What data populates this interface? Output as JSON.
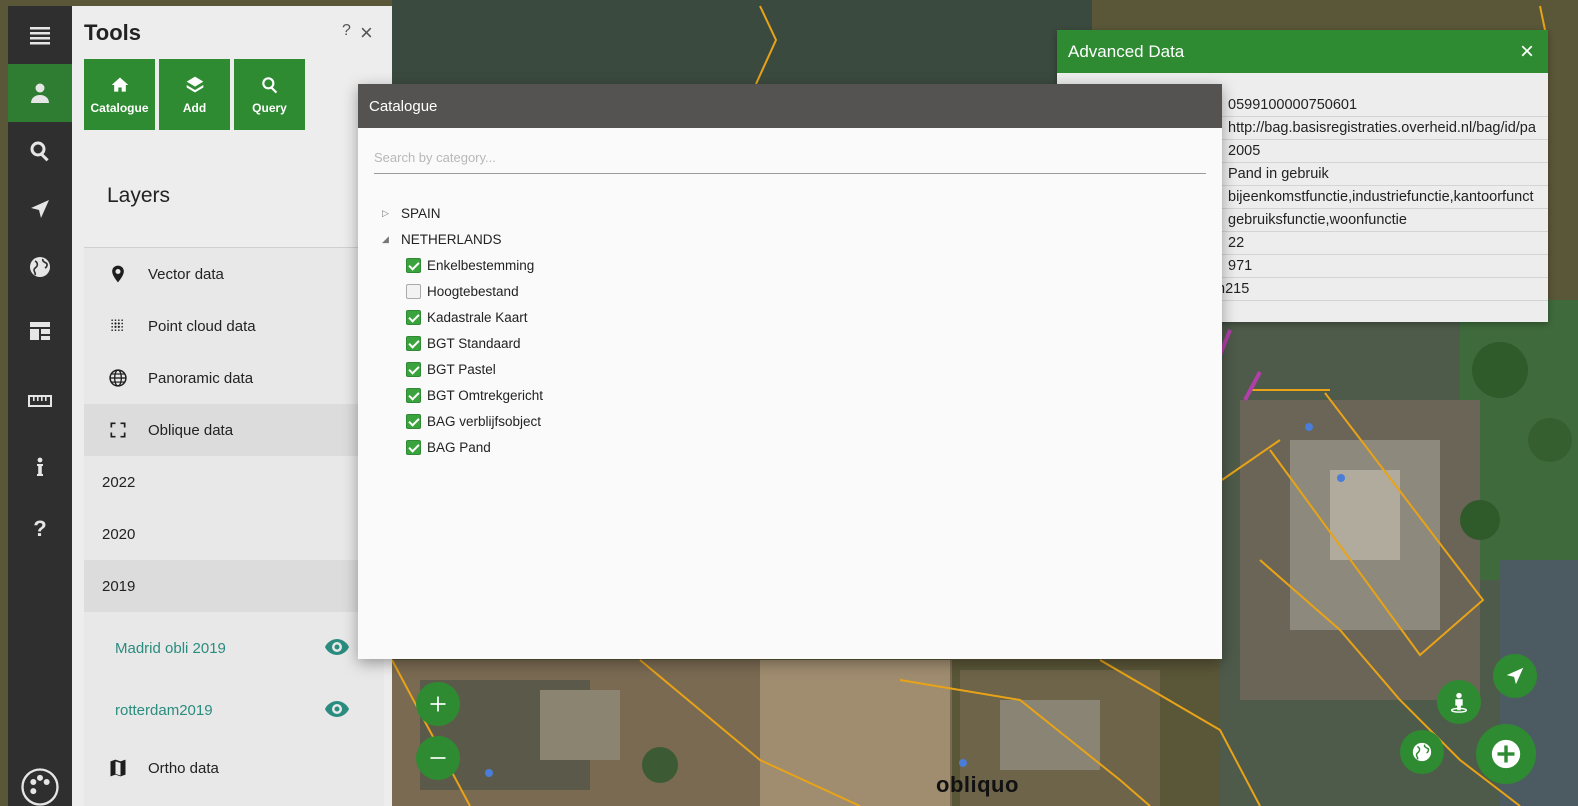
{
  "rail": {
    "items": [
      "menu",
      "user",
      "search",
      "navigate",
      "globe",
      "dashboard",
      "measure",
      "info",
      "help",
      "palette"
    ]
  },
  "tools": {
    "title": "Tools",
    "help": "?",
    "close": "×",
    "buttons": [
      {
        "label": "Catalogue",
        "icon": "home-icon"
      },
      {
        "label": "Add",
        "icon": "layers-icon"
      },
      {
        "label": "Query",
        "icon": "search-icon"
      }
    ]
  },
  "layers": {
    "title": "Layers",
    "categories": [
      {
        "label": "Vector data",
        "icon": "map-marker-icon"
      },
      {
        "label": "Point cloud data",
        "icon": "point-cloud-icon"
      },
      {
        "label": "Panoramic data",
        "icon": "globe-icon"
      },
      {
        "label": "Oblique data",
        "icon": "expand-icon"
      }
    ],
    "years": [
      "2022",
      "2020",
      "2019"
    ],
    "sublayers": [
      "Madrid obli 2019",
      "rotterdam2019"
    ],
    "ortho": {
      "label": "Ortho data",
      "icon": "map-icon"
    }
  },
  "advanced": {
    "title": "Advanced Data",
    "close": "×",
    "values": [
      "0599100000750601",
      "http://bag.basisregistraties.overheid.nl/bag/id/pa",
      "2005",
      "Pand in gebruik",
      "bijeenkomstfunctie,industriefunctie,kantoorfunct",
      "gebruiksfunctie,woonfunctie",
      "22",
      "971",
      "n215"
    ]
  },
  "catalogue": {
    "title": "Catalogue",
    "search_placeholder": "Search by category...",
    "groups": [
      {
        "label": "SPAIN",
        "expanded": false
      },
      {
        "label": "NETHERLANDS",
        "expanded": true
      }
    ],
    "items": [
      {
        "label": "Enkelbestemming",
        "checked": true
      },
      {
        "label": "Hoogtebestand",
        "checked": false
      },
      {
        "label": "Kadastrale Kaart",
        "checked": true
      },
      {
        "label": "BGT Standaard",
        "checked": true
      },
      {
        "label": "BGT Pastel",
        "checked": true
      },
      {
        "label": "BGT Omtrekgericht",
        "checked": true
      },
      {
        "label": "BAG verblijfsobject",
        "checked": true
      },
      {
        "label": "BAG Pand",
        "checked": true
      }
    ]
  },
  "map": {
    "logo": "obliquo",
    "accent": "#2e8b32",
    "outline_color": "#e8a317"
  }
}
